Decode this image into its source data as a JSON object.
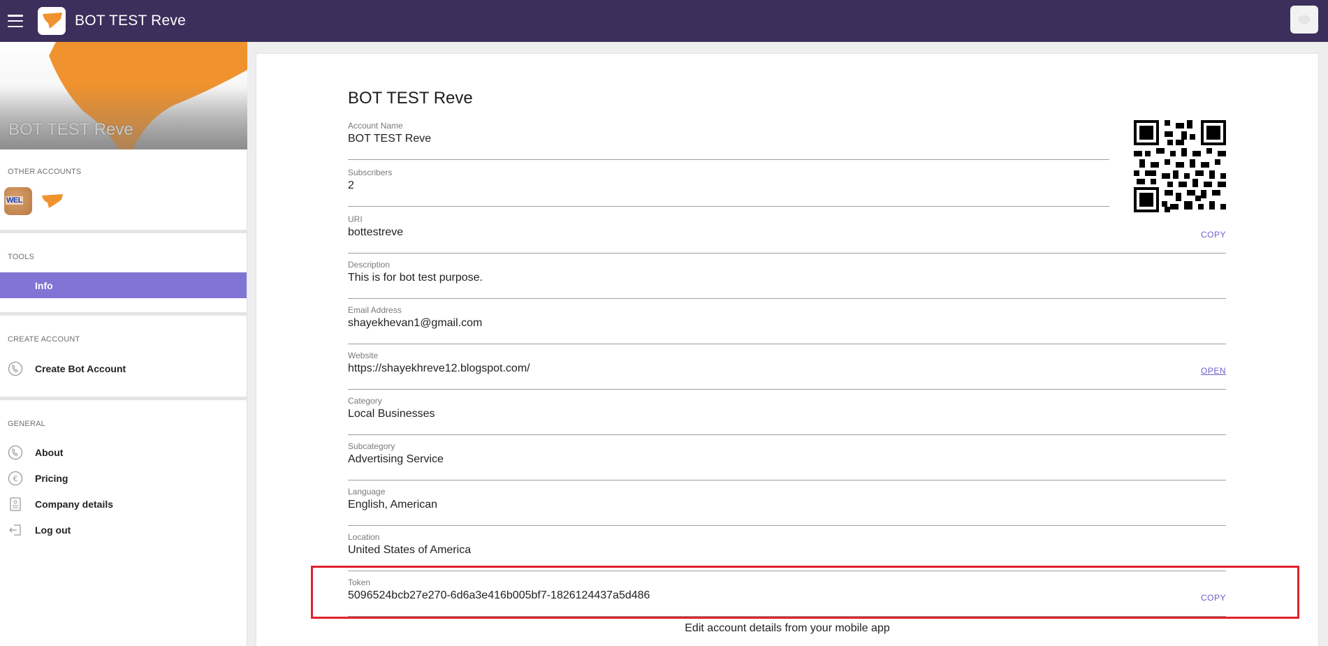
{
  "header": {
    "title": "BOT TEST Reve"
  },
  "sidebar": {
    "cover_title": "BOT TEST Reve",
    "other_accounts_label": "OTHER ACCOUNTS",
    "tools_label": "TOOLS",
    "tools_items": [
      {
        "label": "Info",
        "icon": "info",
        "active": true
      }
    ],
    "create_account_label": "CREATE ACCOUNT",
    "create_items": [
      {
        "label": "Create Bot Account",
        "icon": "phone-icon"
      }
    ],
    "general_label": "GENERAL",
    "general_items": [
      {
        "label": "About",
        "icon": "phone-icon"
      },
      {
        "label": "Pricing",
        "icon": "euro-icon"
      },
      {
        "label": "Company details",
        "icon": "document-icon"
      },
      {
        "label": "Log out",
        "icon": "logout-icon"
      }
    ],
    "other_accounts_thumb_text": "WEL"
  },
  "main": {
    "heading": "BOT TEST Reve",
    "fields": {
      "account_name": {
        "label": "Account Name",
        "value": "BOT TEST Reve"
      },
      "subscribers": {
        "label": "Subscribers",
        "value": "2"
      },
      "uri": {
        "label": "URI",
        "value": "bottestreve",
        "action": "COPY"
      },
      "description": {
        "label": "Description",
        "value": "This is for bot test purpose."
      },
      "email": {
        "label": "Email Address",
        "value": "shayekhevan1@gmail.com"
      },
      "website": {
        "label": "Website",
        "value": "https://shayekhreve12.blogspot.com/",
        "action": "OPEN"
      },
      "category": {
        "label": "Category",
        "value": "Local Businesses"
      },
      "subcategory": {
        "label": "Subcategory",
        "value": "Advertising Service"
      },
      "language": {
        "label": "Language",
        "value": "English, American"
      },
      "location": {
        "label": "Location",
        "value": "United States of America"
      },
      "token": {
        "label": "Token",
        "value": "5096524bcb27e270-6d6a3e416b005bf7-1826124437a5d486",
        "action": "COPY"
      }
    },
    "footnote": "Edit account details from your mobile app"
  },
  "colors": {
    "topbar": "#3c2f5c",
    "accent": "#8075d4",
    "link": "#6a5fc9",
    "brand_orange": "#f0922e",
    "highlight": "#e0232f"
  }
}
